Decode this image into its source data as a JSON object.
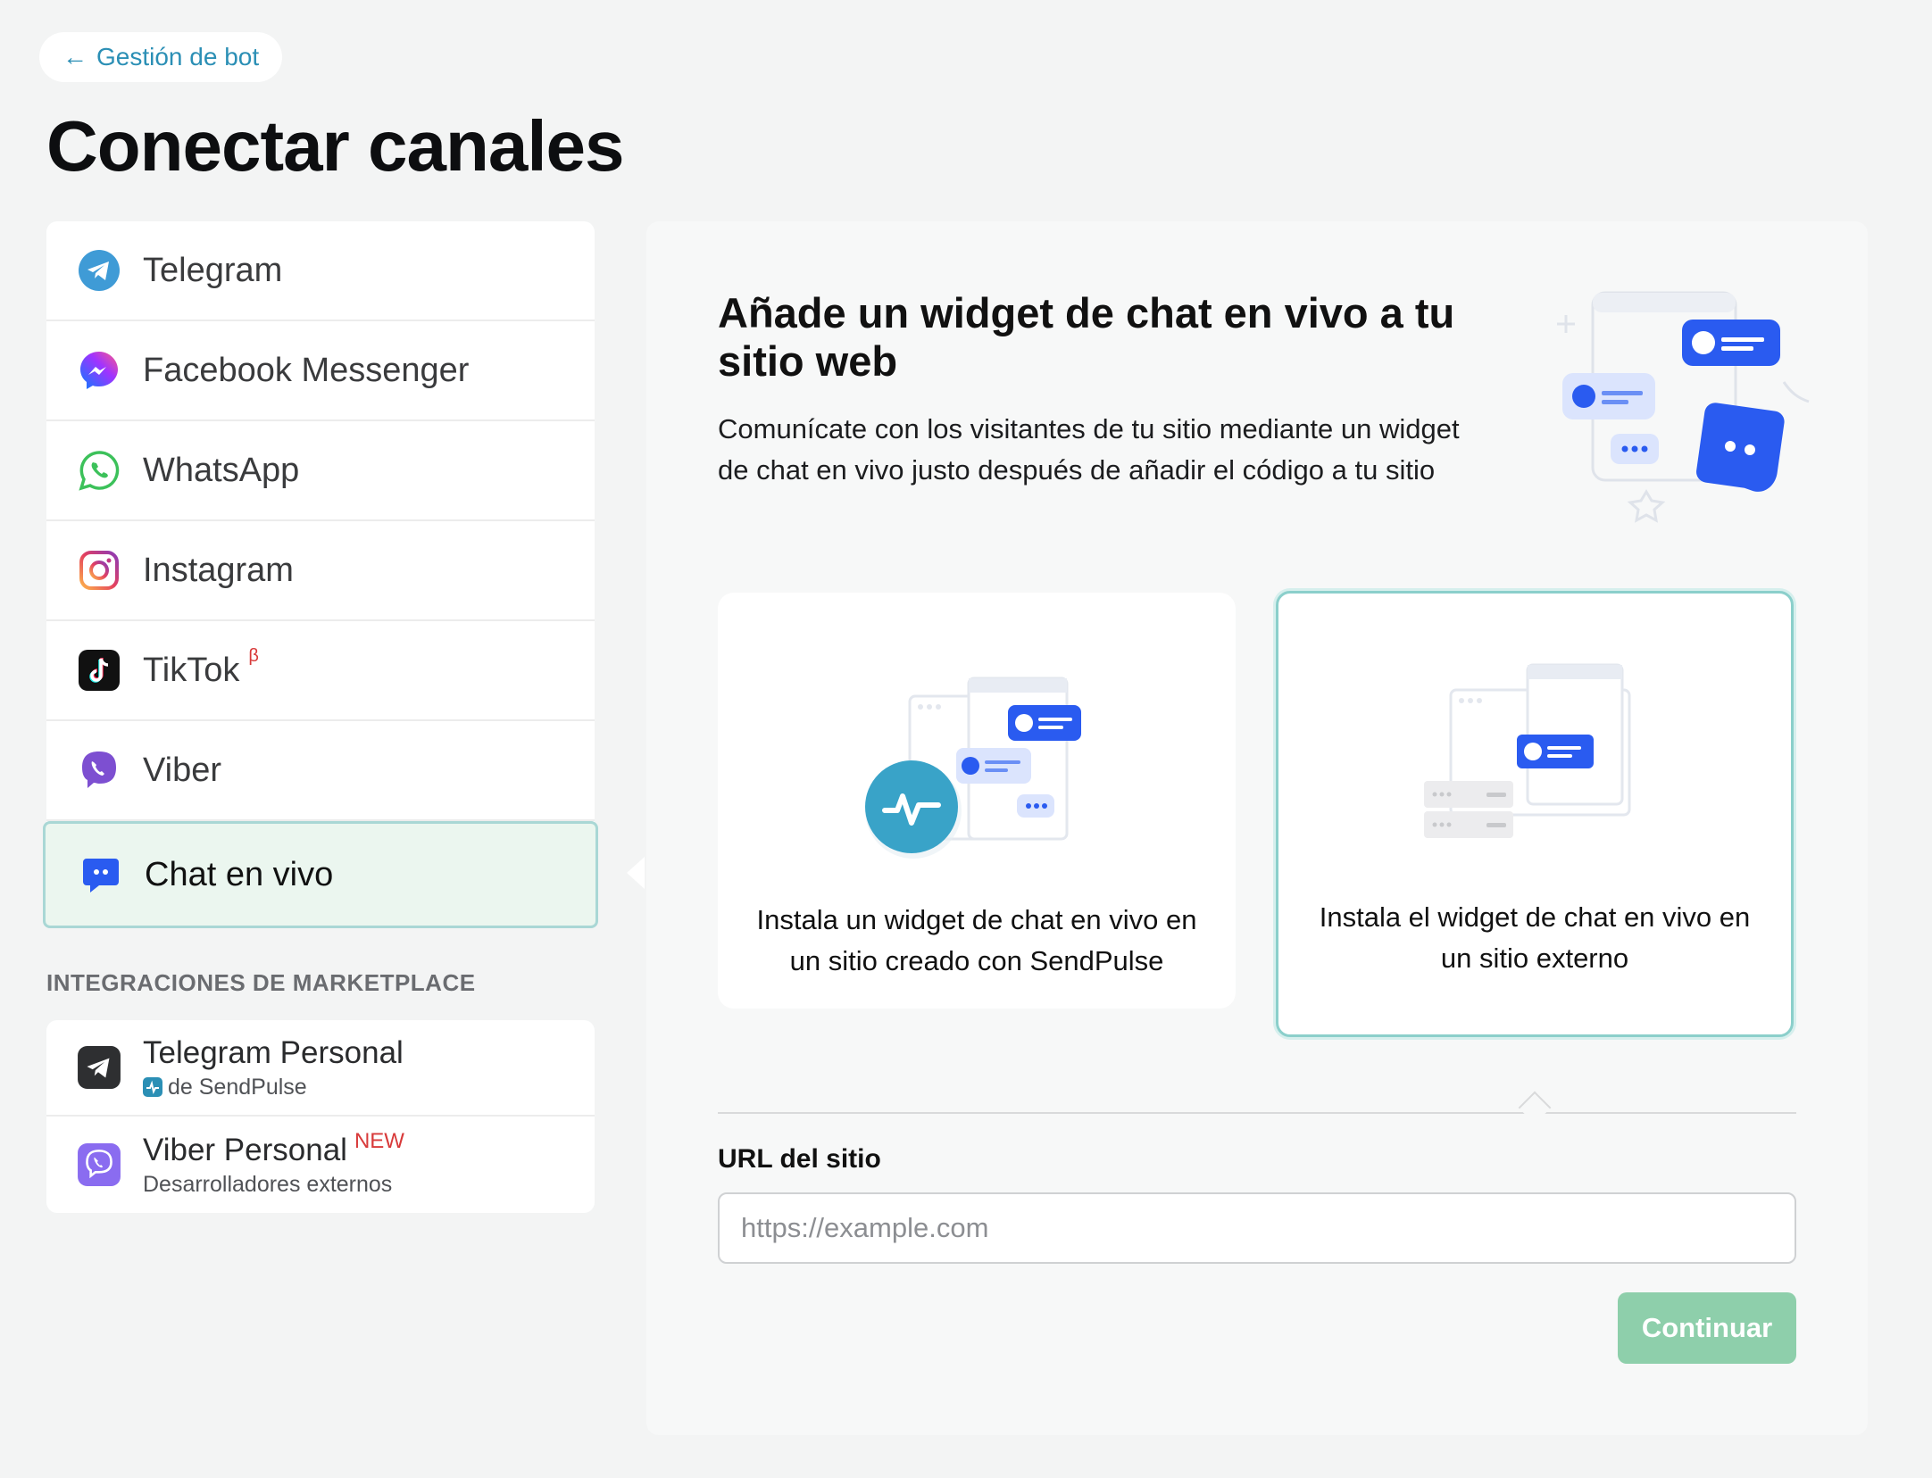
{
  "nav": {
    "back_label": "Gestión de bot"
  },
  "page": {
    "title": "Conectar canales"
  },
  "sidebar": {
    "channels": [
      {
        "label": "Telegram",
        "icon": "telegram-icon"
      },
      {
        "label": "Facebook Messenger",
        "icon": "messenger-icon"
      },
      {
        "label": "WhatsApp",
        "icon": "whatsapp-icon"
      },
      {
        "label": "Instagram",
        "icon": "instagram-icon"
      },
      {
        "label": "TikTok",
        "badge": "β",
        "icon": "tiktok-icon"
      },
      {
        "label": "Viber",
        "icon": "viber-icon"
      },
      {
        "label": "Chat en vivo",
        "icon": "live-chat-icon",
        "active": true
      }
    ],
    "marketplace_title": "INTEGRACIONES DE MARKETPLACE",
    "marketplace": [
      {
        "name": "Telegram Personal",
        "sub": "de SendPulse",
        "icon": "telegram-dark-icon"
      },
      {
        "name": "Viber Personal",
        "badge": "NEW",
        "sub": "Desarrolladores externos",
        "icon": "viber-personal-icon"
      }
    ]
  },
  "panel": {
    "title": "Añade un widget de chat en vivo a tu sitio web",
    "description": "Comunícate con los visitantes de tu sitio mediante un widget de chat en vivo justo después de añadir el código a tu sitio",
    "options": [
      {
        "text": "Instala un widget de chat en vivo en un sitio creado con SendPulse"
      },
      {
        "text": "Instala el widget de chat en vivo en un sitio externo",
        "selected": true
      }
    ],
    "url_label": "URL del sitio",
    "url_placeholder": "https://example.com",
    "url_value": "",
    "continue_label": "Continuar"
  },
  "colors": {
    "accent": "#2b8fb5",
    "active_bg": "#ebf6ef",
    "active_border": "#a9d7d5",
    "button": "#8ecfab",
    "chat_blue": "#2a5bf0"
  }
}
